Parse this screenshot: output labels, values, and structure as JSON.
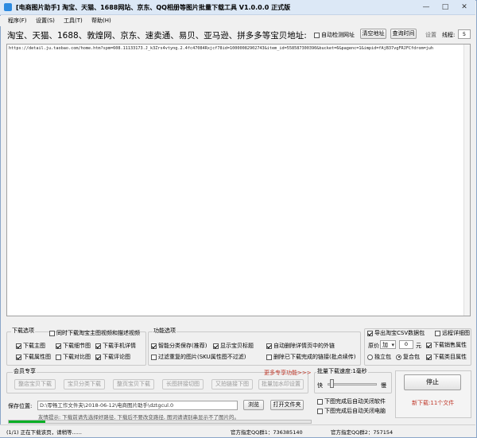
{
  "window": {
    "title": "[电商图片助手]  淘宝、天猫、1688网站、京东、QQ相册等图片批量下载工具 V1.0.0.0 正式版",
    "min_glyph": "—",
    "max_glyph": "□",
    "close_glyph": "✕"
  },
  "menu": [
    "程序(F)",
    "设置(S)",
    "工具(T)",
    "帮助(H)"
  ],
  "url_bar": {
    "label": "淘宝、天猫、1688、敦煌网、京东、速卖通、易贝、亚马逊、拼多多等宝贝地址:",
    "auto_recognize": "自动检测网址",
    "clear_btn": "清空地址",
    "query_time_btn": "查询时间",
    "settings_label": "设置",
    "threads_label": "线程:",
    "threads_value": "5"
  },
  "url_text": "https://detail.ju.taobao.com/home.htm?spm=608.11133173.J_k3Zrs4vtyng.2.4fc47084Rxjcf78id=10000082902743&item_id=558587300390&bucket=6&pagenc=1&impid=fAjB37vgFRJFCfdrom=juh",
  "download_options": {
    "title": "下载选项",
    "items": [
      {
        "label": "同时下载淘宝主图视频和描述视频",
        "checked": false
      },
      {
        "label": "下载主图",
        "checked": true
      },
      {
        "label": "下载细节图",
        "checked": true
      },
      {
        "label": "下载手机详情",
        "checked": true
      },
      {
        "label": "下载属性图",
        "checked": true
      },
      {
        "label": "下载对比图",
        "checked": false
      },
      {
        "label": "下载评论图",
        "checked": true
      }
    ]
  },
  "function_options": {
    "title": "功能选项",
    "items": [
      {
        "label": "智能分类保存(推荐)",
        "checked": true
      },
      {
        "label": "显示宝贝标题",
        "checked": true
      },
      {
        "label": "自动删除详情页中的外链",
        "checked": true
      },
      {
        "label": "过滤重复的图片(SKU属性图不过滤)",
        "checked": false
      },
      {
        "label": "删除已下载完成的链接(批点续传)",
        "checked": false
      }
    ]
  },
  "export": {
    "export_csv": {
      "label": "导出淘宝CSV数据包",
      "checked": true
    },
    "remote_detail": {
      "label": "远程详细图",
      "checked": false
    },
    "price_label": "原价",
    "price_op": "加",
    "price_value": "0",
    "price_unit": "元",
    "download_sales_attr": {
      "label": "下载销售属性",
      "checked": true
    },
    "single_pkg": {
      "label": "独立包",
      "checked": false
    },
    "multi_pkg": {
      "label": "复合包",
      "checked": true
    },
    "download_class_attr": {
      "label": "下载类目属性",
      "checked": true
    }
  },
  "vip": {
    "title": "会员专享",
    "more_link": "更多专享功能>>>",
    "buttons": [
      "整店宝贝下载",
      "宝贝分类下载",
      "整页宝贝下载",
      "长图拼接切图",
      "又拍链接下图",
      "批量加水印设置"
    ]
  },
  "speed": {
    "title": "批量下载速度:1毫秒",
    "fast": "快",
    "slow": "慢",
    "level": 0.05
  },
  "stop_panel": {
    "stop_btn": "停止",
    "new_download_label": "新下载:",
    "new_download_value": "11个文件"
  },
  "save": {
    "label": "保存位置:",
    "path": "D:\\零畅工作文件夹\\2018-06-12\\电商图片助手\\dztgcul.0",
    "browse_btn": "浏览",
    "open_folder_btn": "打开文件夹",
    "tip": "友情提示: 下载前请先选择好路径, 下载后不要改变路径, 图词请请别串显示不了图片的。",
    "progress": 0.12
  },
  "after_download": [
    {
      "label": "下图完成后自动关闭软件",
      "checked": false
    },
    {
      "label": "下图完成后自动关闭电脑",
      "checked": false
    }
  ],
  "status": {
    "left": "(1/1) 正在下载该页，请稍等......",
    "qq1_label": "官方指定QQ群1：",
    "qq1_value": "736385140",
    "qq2_label": "官方指定QQ群2：",
    "qq2_value": "757154"
  }
}
